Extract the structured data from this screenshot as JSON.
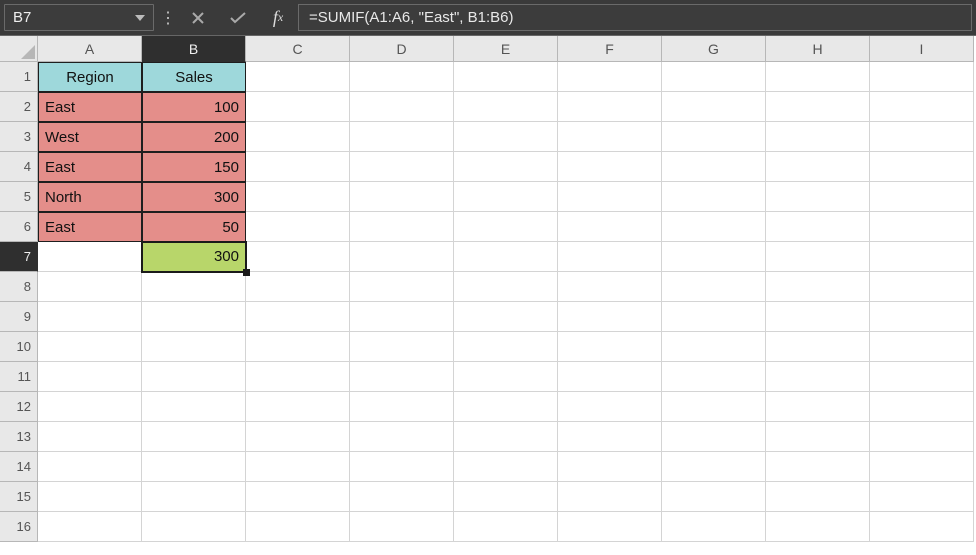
{
  "formula_bar": {
    "cell_reference": "B7",
    "formula": "=SUMIF(A1:A6, \"East\", B1:B6)"
  },
  "columns": [
    "A",
    "B",
    "C",
    "D",
    "E",
    "F",
    "G",
    "H",
    "I"
  ],
  "active_column_index": 1,
  "rows": [
    "1",
    "2",
    "3",
    "4",
    "5",
    "6",
    "7",
    "8",
    "9",
    "10",
    "11",
    "12",
    "13",
    "14",
    "15",
    "16"
  ],
  "active_row_index": 6,
  "grid": {
    "A1": "Region",
    "B1": "Sales",
    "A2": "East",
    "B2": "100",
    "A3": "West",
    "B3": "200",
    "A4": "East",
    "B4": "150",
    "A5": "North",
    "B5": "300",
    "A6": "East",
    "B6": "50",
    "B7": "300"
  },
  "active_cell": "B7",
  "colors": {
    "header_fill": "#9ed8db",
    "data_fill": "#e48e8a",
    "result_fill": "#b8d66a",
    "formula_bar_bg": "#3a3a3a"
  },
  "chart_data": {
    "type": "table",
    "columns": [
      "Region",
      "Sales"
    ],
    "rows": [
      [
        "East",
        100
      ],
      [
        "West",
        200
      ],
      [
        "East",
        150
      ],
      [
        "North",
        300
      ],
      [
        "East",
        50
      ]
    ],
    "computed": {
      "label": "SUMIF East",
      "value": 300
    }
  }
}
